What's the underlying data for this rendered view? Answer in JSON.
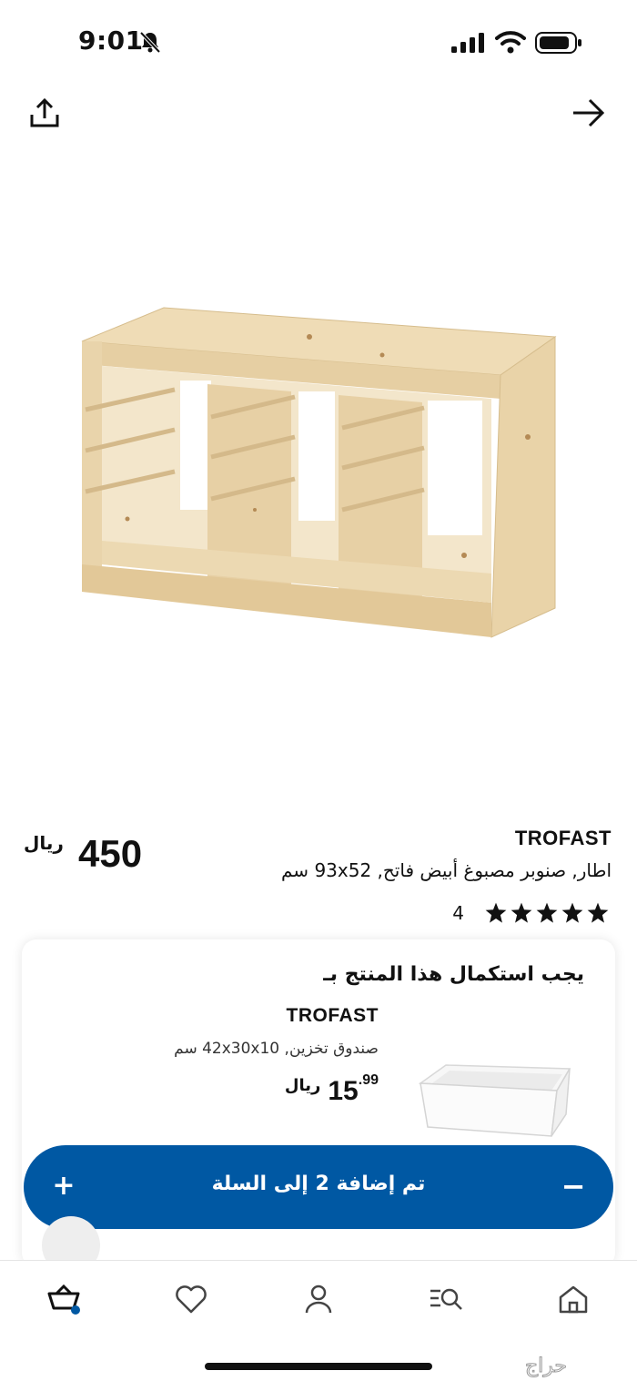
{
  "status_bar": {
    "time": "9:01"
  },
  "product": {
    "name": "TROFAST",
    "description": "اطار, صنوبر مصبوغ أبيض فاتح, 93x52 سم",
    "price": "450",
    "currency": "ريال",
    "rating_count": "4",
    "stars_filled": 5
  },
  "complementary": {
    "title": "يجب استكمال هذا المنتج بـ",
    "item": {
      "name": "TROFAST",
      "description": "صندوق تخزين, 42x30x10 سم",
      "price_integer": "15",
      "price_decimal": ".99",
      "currency": "ريال"
    },
    "cart": {
      "label": "تم إضافة 2 إلى السلة",
      "minus": "−",
      "plus": "+"
    }
  },
  "watermark": "حراج",
  "colors": {
    "accent_blue": "#0058a3",
    "wood": "#ecd9b2"
  }
}
